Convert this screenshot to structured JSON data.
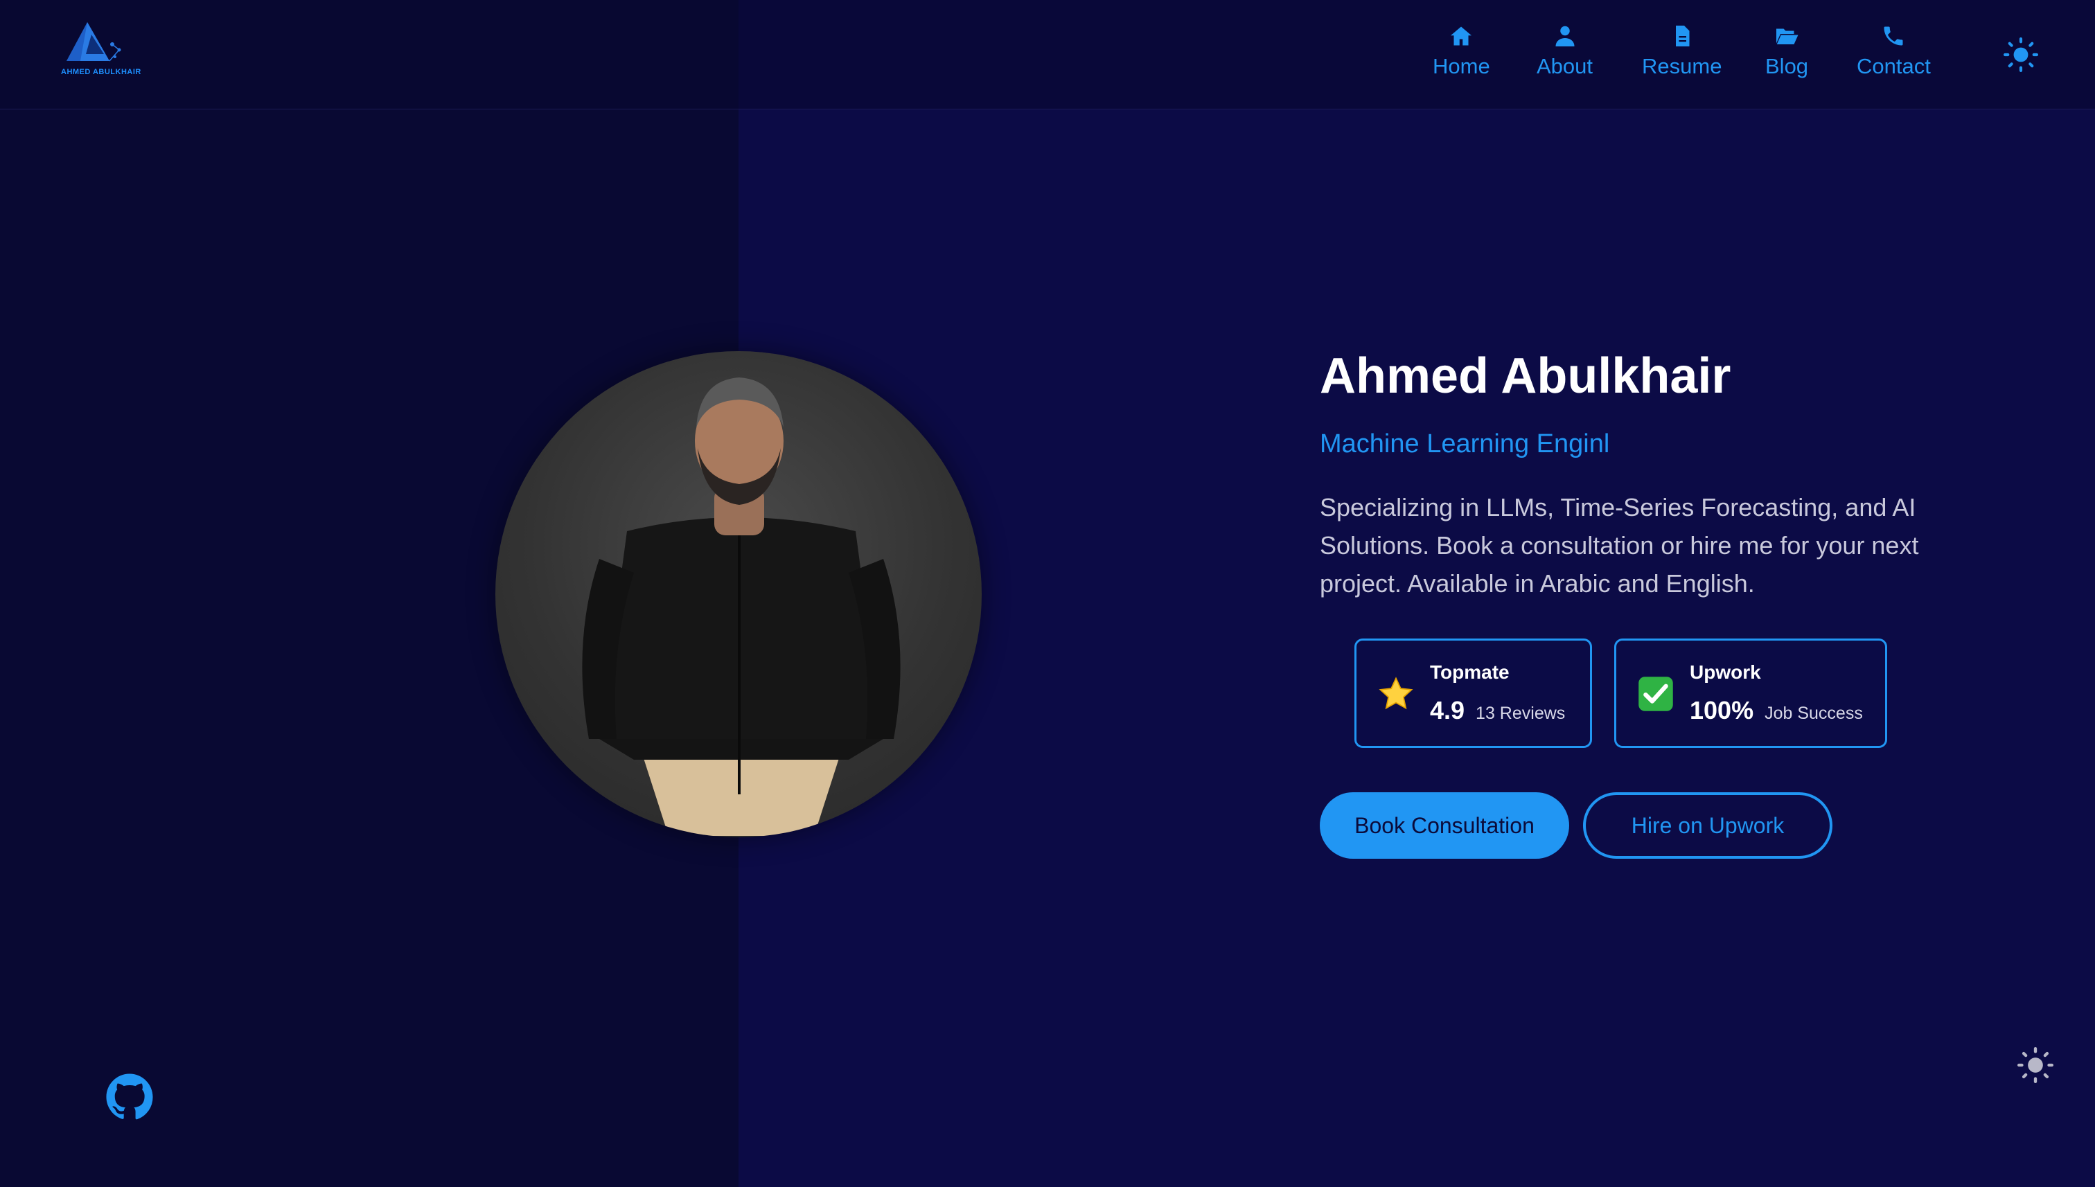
{
  "brand": {
    "logo_text": "AHMED ABULKHAIR",
    "accent_color": "#2196f3",
    "background_color": "#0c0b46"
  },
  "nav": {
    "items": [
      {
        "label": "Home",
        "icon": "home-icon"
      },
      {
        "label": "About",
        "icon": "user-icon"
      },
      {
        "label": "Resume",
        "icon": "document-icon"
      },
      {
        "label": "Blog",
        "icon": "folder-open-icon"
      },
      {
        "label": "Contact",
        "icon": "phone-icon"
      }
    ],
    "theme_toggle_icon": "sun-icon"
  },
  "hero": {
    "name": "Ahmed Abulkhair",
    "title": "Machine Learning Enginl",
    "description": "Specializing in LLMs, Time-Series Forecasting, and AI Solutions. Book a consultation or hire me for your next project. Available in Arabic and English.",
    "photo_icon": "profile-photo"
  },
  "stats": [
    {
      "platform": "Topmate",
      "value": "4.9",
      "sub": "13 Reviews",
      "icon": "star-icon"
    },
    {
      "platform": "Upwork",
      "value": "100%",
      "sub": "Job Success",
      "icon": "check-box-icon"
    }
  ],
  "buttons": {
    "primary": "Book Consultation",
    "secondary": "Hire on Upwork"
  },
  "footer": {
    "github_icon": "github-icon",
    "theme_toggle_icon": "sun-icon"
  }
}
